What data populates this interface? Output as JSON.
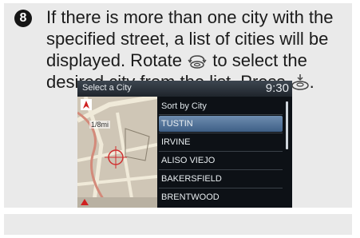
{
  "step": {
    "number": "8"
  },
  "instruction": {
    "line_before_rotate": "If there is more than one city with the specified street, a list of cities will be displayed. Rotate",
    "line_after_rotate": "to select the desired city from the list. Press",
    "line_end": "."
  },
  "screen": {
    "title": "Select a City",
    "clock": "9:30",
    "map_scale": "1/8mi",
    "sort_label": "Sort by City",
    "cities": [
      "TUSTIN",
      "IRVINE",
      "ALISO VIEJO",
      "BAKERSFIELD",
      "BRENTWOOD"
    ],
    "selected_index": 0
  },
  "icons": {
    "rotate": "rotate-dial-icon",
    "press": "press-dial-icon"
  }
}
